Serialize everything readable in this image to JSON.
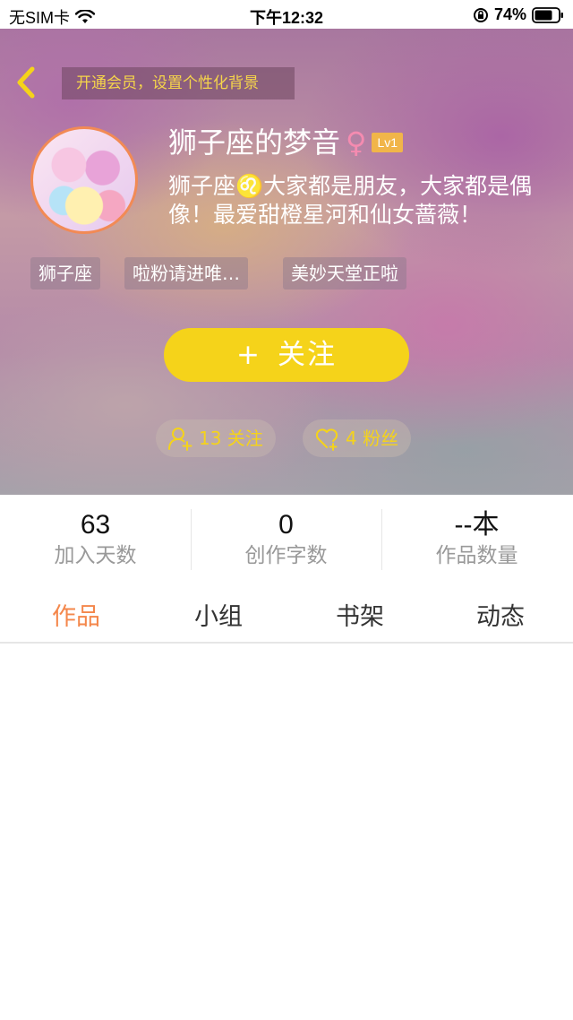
{
  "status_bar": {
    "carrier": "无SIM卡",
    "time": "下午12:32",
    "battery": "74%"
  },
  "header": {
    "vip_banner": "开通会员，设置个性化背景"
  },
  "profile": {
    "username": "狮子座的梦音",
    "gender_symbol": "♀",
    "level": "Lv1",
    "bio": "狮子座♌️大家都是朋友，大家都是偶像！最爱甜橙星河和仙女蔷薇！",
    "tags": [
      "狮子座",
      "啦粉请进唯…",
      "美妙天堂正啦"
    ]
  },
  "follow_button": {
    "plus": "+",
    "label": "关注"
  },
  "social": {
    "following": "13 关注",
    "fans": "4 粉丝"
  },
  "stats": [
    {
      "value": "63",
      "label": "加入天数"
    },
    {
      "value": "0",
      "label": "创作字数"
    },
    {
      "value": "--本",
      "label": "作品数量"
    }
  ],
  "tabs": [
    {
      "label": "作品",
      "active": true
    },
    {
      "label": "小组",
      "active": false
    },
    {
      "label": "书架",
      "active": false
    },
    {
      "label": "动态",
      "active": false
    }
  ],
  "colors": {
    "accent_yellow": "#f5d31a",
    "tab_active": "#f4874b",
    "level_badge": "#f1b549",
    "avatar_border": "#f28a55"
  }
}
